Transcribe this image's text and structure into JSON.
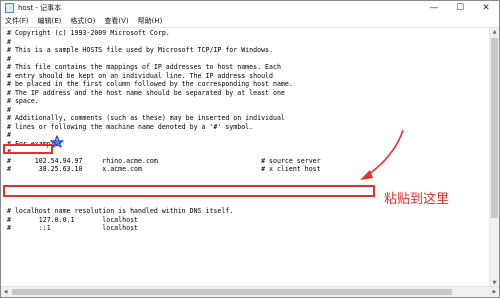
{
  "window": {
    "title": "host - 记事本",
    "controls": [
      "—",
      "☐",
      "✕"
    ]
  },
  "menu": [
    "文件(F)",
    "编辑(E)",
    "格式(O)",
    "查看(V)",
    "帮助(H)"
  ],
  "lines": [
    "# Copyright (c) 1993-2009 Microsoft Corp.",
    "#",
    "# This is a sample HOSTS file used by Microsoft TCP/IP for Windows.",
    "#",
    "# This file contains the mappings of IP addresses to host names. Each",
    "# entry should be kept on an individual line. The IP address should",
    "# be placed in the first column followed by the corresponding host name.",
    "# The IP address and the host name should be separated by at least one",
    "# space.",
    "#",
    "# Additionally, comments (such as these) may be inserted on individual",
    "# lines or following the machine name denoted by a '#' symbol.",
    "#",
    "# For example:",
    "#",
    "#      102.54.94.97     rhino.acme.com                          # source server",
    "#       38.25.63.10     x.acme.com                              # x client host",
    "",
    "",
    "",
    "# localhost name resolution is handled within DNS itself.",
    "#       127.0.0.1       localhost",
    "#       ::1             localhost"
  ],
  "annotation": {
    "label": "粘贴到这里",
    "color": "#e8302f"
  }
}
